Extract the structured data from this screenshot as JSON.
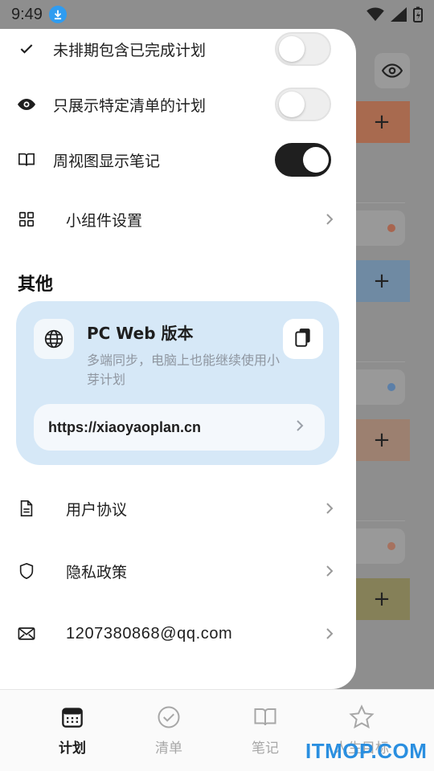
{
  "status": {
    "time": "9:49"
  },
  "settings": {
    "toggles": [
      {
        "label": "未排期包含已完成计划",
        "on": false,
        "icon": "check-icon"
      },
      {
        "label": "只展示特定清单的计划",
        "on": false,
        "icon": "eye-icon"
      },
      {
        "label": "周视图显示笔记",
        "on": true,
        "icon": "book-icon"
      }
    ],
    "widget": {
      "label": "小组件设置",
      "icon": "grid-icon"
    }
  },
  "other": {
    "title": "其他",
    "pc_card": {
      "title": "PC Web 版本",
      "desc": "多端同步，电脑上也能继续使用小芽计划",
      "url": "https://xiaoyaoplan.cn"
    },
    "links": [
      {
        "label": "用户协议",
        "icon": "document-icon"
      },
      {
        "label": "隐私政策",
        "icon": "shield-icon"
      },
      {
        "label": "1207380868@qq.com",
        "icon": "mail-icon"
      }
    ]
  },
  "bottom_nav": {
    "tabs": [
      {
        "label": "计划",
        "icon": "calendar-icon",
        "active": true
      },
      {
        "label": "清单",
        "icon": "check-circle-icon",
        "active": false
      },
      {
        "label": "笔记",
        "icon": "book-icon",
        "active": false
      },
      {
        "label": "人生目标",
        "icon": "star-icon",
        "active": false
      }
    ]
  },
  "watermark": "ITMOP.COM",
  "colors": {
    "card_bg": "#d6e8f7",
    "switch_on": "#1f1f1f",
    "accent_blue": "#2f9cf0"
  }
}
